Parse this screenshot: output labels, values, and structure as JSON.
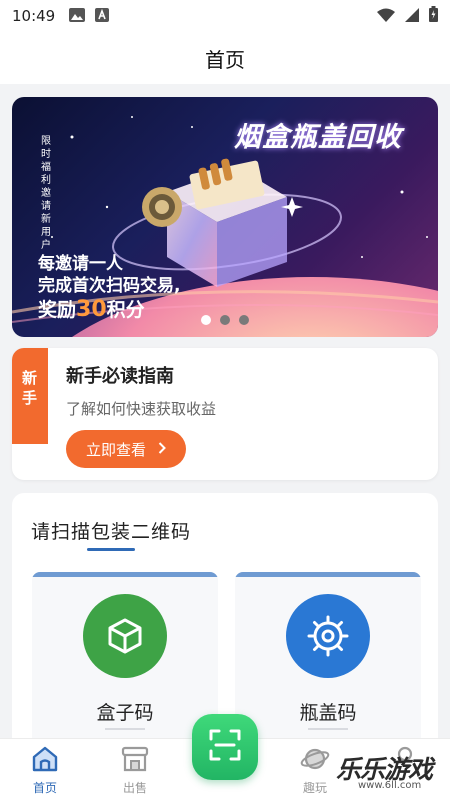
{
  "status_bar": {
    "time": "10:49",
    "icons": [
      "image-icon",
      "text-a-icon",
      "wifi-icon",
      "signal-icon",
      "battery-icon"
    ]
  },
  "header": {
    "title": "首页"
  },
  "banner": {
    "side_text": "限时福利邀请新用户",
    "headline": "烟盒瓶盖回收",
    "line1": "每邀请一人",
    "line2": "完成首次扫码交易,",
    "line3_prefix": "奖励",
    "line3_highlight": "30",
    "line3_suffix": "积分",
    "active_slide": 1,
    "total_slides": 3
  },
  "guide": {
    "ribbon": "新手",
    "title": "新手必读指南",
    "subtitle": "了解如何快速获取收益",
    "button_label": "立即查看",
    "accent": "#f26a2e"
  },
  "scan_section": {
    "title": "请扫描包装二维码",
    "cards": [
      {
        "label": "盒子码",
        "icon": "box-icon",
        "color": "#3ea346"
      },
      {
        "label": "瓶盖码",
        "icon": "bottle-cap-icon",
        "color": "#2a78d4"
      }
    ]
  },
  "bottom_nav": {
    "items": [
      {
        "label": "首页",
        "icon": "home-icon",
        "active": true
      },
      {
        "label": "出售",
        "icon": "shop-icon",
        "active": false
      },
      {
        "label": "趣玩",
        "icon": "planet-icon",
        "active": false
      },
      {
        "label": "",
        "icon": "user-icon",
        "active": false
      }
    ],
    "scan_icon": "scan-icon",
    "active_color": "#2f6ab6"
  },
  "watermark": {
    "text": "乐乐游戏",
    "url": "www.6ll.com"
  }
}
